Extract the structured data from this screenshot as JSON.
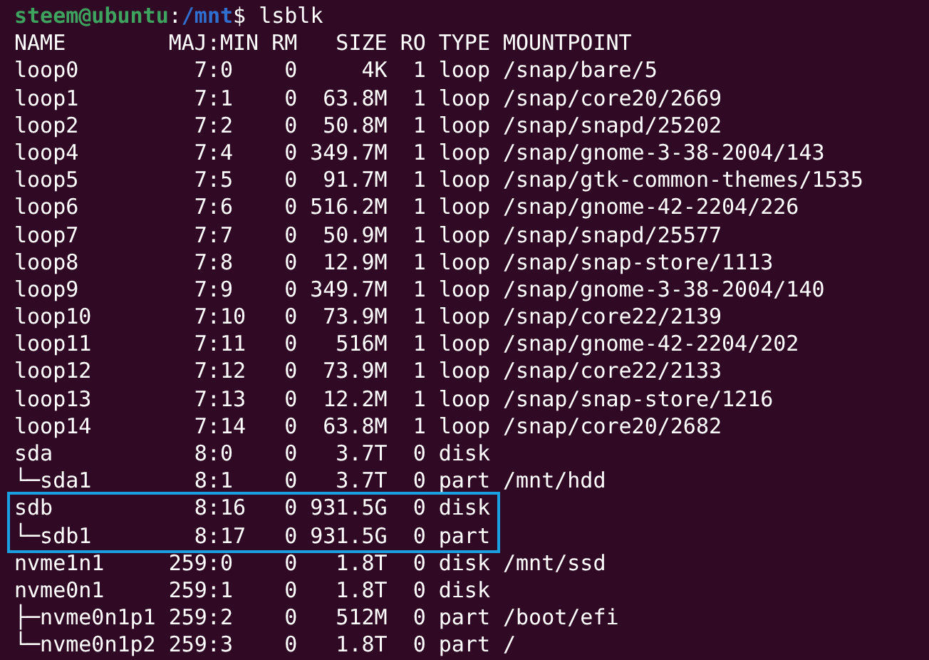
{
  "prompt": {
    "user_host": "steem@ubuntu",
    "separator": ":",
    "path": "/mnt",
    "symbol": "$",
    "command": "lsblk"
  },
  "columns": [
    "NAME",
    "MAJ:MIN",
    "RM",
    "SIZE",
    "RO",
    "TYPE",
    "MOUNTPOINT"
  ],
  "rows": [
    {
      "name": "loop0",
      "majmin": "7:0",
      "rm": "0",
      "size": "4K",
      "ro": "1",
      "type": "loop",
      "mountpoint": "/snap/bare/5",
      "highlighted": false
    },
    {
      "name": "loop1",
      "majmin": "7:1",
      "rm": "0",
      "size": "63.8M",
      "ro": "1",
      "type": "loop",
      "mountpoint": "/snap/core20/2669",
      "highlighted": false
    },
    {
      "name": "loop2",
      "majmin": "7:2",
      "rm": "0",
      "size": "50.8M",
      "ro": "1",
      "type": "loop",
      "mountpoint": "/snap/snapd/25202",
      "highlighted": false
    },
    {
      "name": "loop4",
      "majmin": "7:4",
      "rm": "0",
      "size": "349.7M",
      "ro": "1",
      "type": "loop",
      "mountpoint": "/snap/gnome-3-38-2004/143",
      "highlighted": false
    },
    {
      "name": "loop5",
      "majmin": "7:5",
      "rm": "0",
      "size": "91.7M",
      "ro": "1",
      "type": "loop",
      "mountpoint": "/snap/gtk-common-themes/1535",
      "highlighted": false
    },
    {
      "name": "loop6",
      "majmin": "7:6",
      "rm": "0",
      "size": "516.2M",
      "ro": "1",
      "type": "loop",
      "mountpoint": "/snap/gnome-42-2204/226",
      "highlighted": false
    },
    {
      "name": "loop7",
      "majmin": "7:7",
      "rm": "0",
      "size": "50.9M",
      "ro": "1",
      "type": "loop",
      "mountpoint": "/snap/snapd/25577",
      "highlighted": false
    },
    {
      "name": "loop8",
      "majmin": "7:8",
      "rm": "0",
      "size": "12.9M",
      "ro": "1",
      "type": "loop",
      "mountpoint": "/snap/snap-store/1113",
      "highlighted": false
    },
    {
      "name": "loop9",
      "majmin": "7:9",
      "rm": "0",
      "size": "349.7M",
      "ro": "1",
      "type": "loop",
      "mountpoint": "/snap/gnome-3-38-2004/140",
      "highlighted": false
    },
    {
      "name": "loop10",
      "majmin": "7:10",
      "rm": "0",
      "size": "73.9M",
      "ro": "1",
      "type": "loop",
      "mountpoint": "/snap/core22/2139",
      "highlighted": false
    },
    {
      "name": "loop11",
      "majmin": "7:11",
      "rm": "0",
      "size": "516M",
      "ro": "1",
      "type": "loop",
      "mountpoint": "/snap/gnome-42-2204/202",
      "highlighted": false
    },
    {
      "name": "loop12",
      "majmin": "7:12",
      "rm": "0",
      "size": "73.9M",
      "ro": "1",
      "type": "loop",
      "mountpoint": "/snap/core22/2133",
      "highlighted": false
    },
    {
      "name": "loop13",
      "majmin": "7:13",
      "rm": "0",
      "size": "12.2M",
      "ro": "1",
      "type": "loop",
      "mountpoint": "/snap/snap-store/1216",
      "highlighted": false
    },
    {
      "name": "loop14",
      "majmin": "7:14",
      "rm": "0",
      "size": "63.8M",
      "ro": "1",
      "type": "loop",
      "mountpoint": "/snap/core20/2682",
      "highlighted": false
    },
    {
      "name": "sda",
      "majmin": "8:0",
      "rm": "0",
      "size": "3.7T",
      "ro": "0",
      "type": "disk",
      "highlighted": false
    },
    {
      "name": "└─sda1",
      "majmin": "8:1",
      "rm": "0",
      "size": "3.7T",
      "ro": "0",
      "type": "part",
      "mountpoint": "/mnt/hdd",
      "highlighted": false
    },
    {
      "name": "sdb",
      "majmin": "8:16",
      "rm": "0",
      "size": "931.5G",
      "ro": "0",
      "type": "disk",
      "highlighted": true
    },
    {
      "name": "└─sdb1",
      "majmin": "8:17",
      "rm": "0",
      "size": "931.5G",
      "ro": "0",
      "type": "part",
      "highlighted": true
    },
    {
      "name": "nvme1n1",
      "majmin": "259:0",
      "rm": "0",
      "size": "1.8T",
      "ro": "0",
      "type": "disk",
      "mountpoint": "/mnt/ssd",
      "highlighted": false
    },
    {
      "name": "nvme0n1",
      "majmin": "259:1",
      "rm": "0",
      "size": "1.8T",
      "ro": "0",
      "type": "disk",
      "highlighted": false
    },
    {
      "name": "├─nvme0n1p1",
      "majmin": "259:2",
      "rm": "0",
      "size": "512M",
      "ro": "0",
      "type": "part",
      "mountpoint": "/boot/efi",
      "highlighted": false
    },
    {
      "name": "└─nvme0n1p2",
      "majmin": "259:3",
      "rm": "0",
      "size": "1.8T",
      "ro": "0",
      "type": "part",
      "mountpoint": "/",
      "highlighted": false
    }
  ]
}
